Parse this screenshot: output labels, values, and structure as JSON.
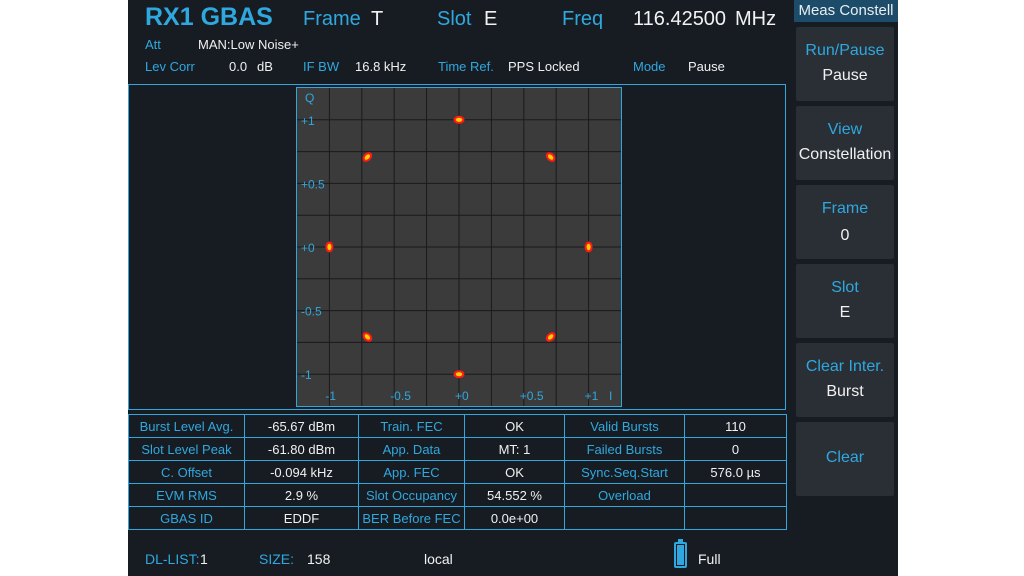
{
  "header": {
    "title": "RX1 GBAS",
    "frame_label": "Frame",
    "frame_value": "T",
    "slot_label": "Slot",
    "slot_value": "E",
    "freq_label": "Freq",
    "freq_value": "116.42500",
    "freq_unit": "MHz",
    "att_label": "Att",
    "att_value": "MAN:Low Noise+",
    "lev_corr_label": "Lev Corr",
    "lev_corr_value": "0.0",
    "lev_corr_unit": "dB",
    "if_bw_label": "IF BW",
    "if_bw_value": "16.8 kHz",
    "time_ref_label": "Time Ref.",
    "time_ref_value": "PPS Locked",
    "mode_label": "Mode",
    "mode_value": "Pause"
  },
  "plot": {
    "q_axis_label": "Q",
    "i_axis_label": "I",
    "y_ticks": [
      "+1",
      "+0.5",
      "+0",
      "-0.5",
      "-1"
    ],
    "x_ticks": [
      "-1",
      "-0.5",
      "+0",
      "+0.5",
      "+1"
    ],
    "colors": {
      "background": "#3b3b3b",
      "grid": "#1a1a1a",
      "point_outer": "#ff1a1a",
      "point_inner": "#ffd000"
    },
    "constellation_points": [
      {
        "i": 0.0,
        "q": 1.0
      },
      {
        "i": 0.7071,
        "q": 0.7071
      },
      {
        "i": 1.0,
        "q": 0.0
      },
      {
        "i": 0.7071,
        "q": -0.7071
      },
      {
        "i": 0.0,
        "q": -1.0
      },
      {
        "i": -0.7071,
        "q": -0.7071
      },
      {
        "i": -1.0,
        "q": 0.0
      },
      {
        "i": -0.7071,
        "q": 0.7071
      }
    ]
  },
  "table": {
    "rows": [
      [
        "Burst Level Avg.",
        "-65.67 dBm",
        "Train. FEC",
        "OK",
        "Valid Bursts",
        "110"
      ],
      [
        "Slot Level Peak",
        "-61.80 dBm",
        "App. Data",
        "MT: 1",
        "Failed Bursts",
        "0"
      ],
      [
        "C. Offset",
        "-0.094 kHz",
        "App. FEC",
        "OK",
        "Sync.Seq.Start",
        "576.0 µs"
      ],
      [
        "EVM RMS",
        "2.9 %",
        "Slot Occupancy",
        "54.552 %",
        "Overload",
        ""
      ],
      [
        "GBAS ID",
        "EDDF",
        "BER Before FEC",
        "0.0e+00",
        "",
        ""
      ]
    ]
  },
  "footer": {
    "dl_list_label": "DL-LIST:",
    "dl_list_value": "1",
    "size_label": "SIZE:",
    "size_value": "158",
    "location": "local",
    "battery_status": "Full"
  },
  "softkeys": {
    "menu_title": "Meas Constell",
    "keys": [
      {
        "label": "Run/Pause",
        "value": "Pause"
      },
      {
        "label": "View",
        "value": "Constellation"
      },
      {
        "label": "Frame",
        "value": "0"
      },
      {
        "label": "Slot",
        "value": "E"
      },
      {
        "label": "Clear Inter.",
        "value": "Burst"
      },
      {
        "label": "Clear",
        "value": ""
      }
    ]
  }
}
